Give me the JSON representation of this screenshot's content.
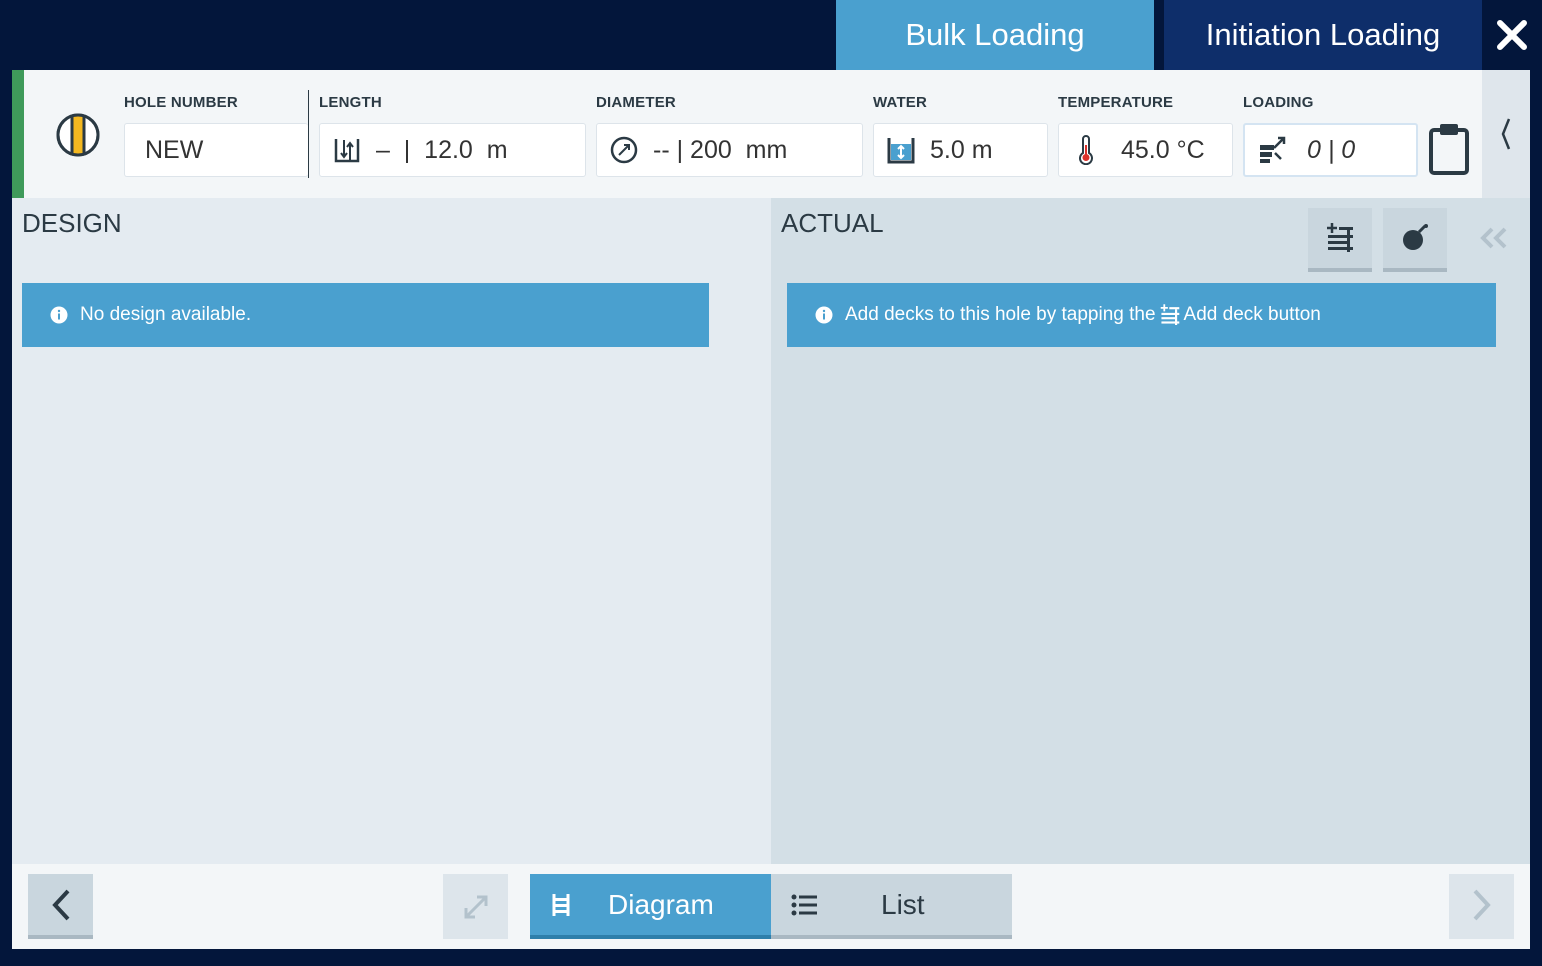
{
  "tabs": {
    "bulk_loading": "Bulk Loading",
    "initiation_loading": "Initiation Loading"
  },
  "header": {
    "hole_number": {
      "label": "HOLE NUMBER",
      "value": "NEW"
    },
    "length": {
      "label": "LENGTH",
      "value": "–  |  12.0  m"
    },
    "diameter": {
      "label": "DIAMETER",
      "value": "-- | 200  mm"
    },
    "water": {
      "label": "WATER",
      "value": "5.0 m"
    },
    "temperature": {
      "label": "TEMPERATURE",
      "value": "45.0 °C"
    },
    "loading": {
      "label": "LOADING",
      "value": "0 | 0"
    }
  },
  "design": {
    "title": "DESIGN",
    "message": "No design available."
  },
  "actual": {
    "title": "ACTUAL",
    "message_prefix": "Add decks to this hole by tapping the",
    "message_suffix": "Add deck button"
  },
  "footer": {
    "diagram_label": "Diagram",
    "list_label": "List"
  },
  "icons": {
    "hole": "hole-status-icon",
    "length": "length-icon",
    "diameter": "diameter-icon",
    "water": "water-icon",
    "temperature": "thermometer-icon",
    "loading": "loading-icon",
    "clipboard": "clipboard-icon"
  },
  "colors": {
    "accent": "#4aa0cf",
    "dark_navy": "#03163b",
    "tab_dark": "#0e2e6a",
    "status_green": "#3f9a5a",
    "hole_yellow": "#f4b820"
  }
}
